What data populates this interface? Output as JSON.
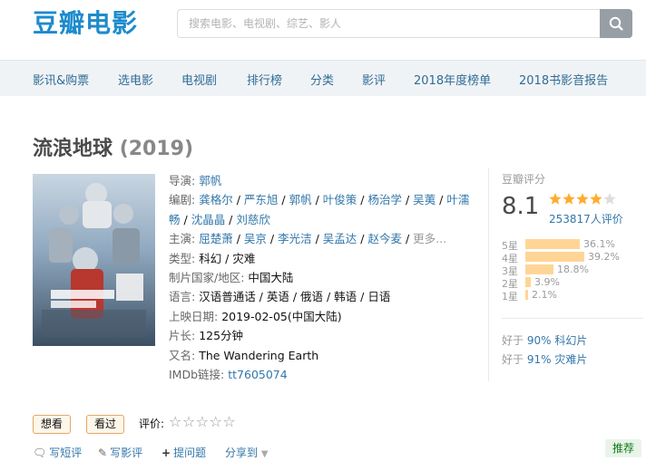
{
  "header": {
    "logo": "豆瓣电影",
    "search_placeholder": "搜索电影、电视剧、综艺、影人",
    "search_icon": "search-icon",
    "brand_color": "#1d8bcc"
  },
  "nav": {
    "items": [
      "影讯&购票",
      "选电影",
      "电视剧",
      "排行榜",
      "分类",
      "影评",
      "2018年度榜单",
      "2018书影音报告"
    ]
  },
  "movie": {
    "title": "流浪地球",
    "year": "(2019)",
    "info": {
      "director_label": "导演:",
      "director": "郭帆",
      "writer_label": "编剧:",
      "writers": [
        "龚格尔",
        "严东旭",
        "郭帆",
        "叶俊策",
        "杨治学",
        "吴荑",
        "叶濡畅",
        "沈晶晶",
        "刘慈欣"
      ],
      "cast_label": "主演:",
      "cast": [
        "屈楚萧",
        "吴京",
        "李光洁",
        "吴孟达",
        "赵今麦"
      ],
      "cast_more": "更多...",
      "genre_label": "类型:",
      "genre": "科幻 / 灾难",
      "country_label": "制片国家/地区:",
      "country": "中国大陆",
      "language_label": "语言:",
      "language": "汉语普通话 / 英语 / 俄语 / 韩语 / 日语",
      "release_label": "上映日期:",
      "release": "2019-02-05(中国大陆)",
      "runtime_label": "片长:",
      "runtime": "125分钟",
      "aka_label": "又名:",
      "aka": "The Wandering Earth",
      "imdb_label": "IMDb链接:",
      "imdb": "tt7605074"
    }
  },
  "rating": {
    "label": "豆瓣评分",
    "score": "8.1",
    "stars": 4,
    "votes": "253817人评价",
    "breakdown": [
      {
        "label": "5星",
        "pct": "36.1%",
        "value": 36.1
      },
      {
        "label": "4星",
        "pct": "39.2%",
        "value": 39.2
      },
      {
        "label": "3星",
        "pct": "18.8%",
        "value": 18.8
      },
      {
        "label": "2星",
        "pct": "3.9%",
        "value": 3.9
      },
      {
        "label": "1星",
        "pct": "2.1%",
        "value": 2.1
      }
    ],
    "better_than": [
      {
        "prefix": "好于",
        "pct": "90%",
        "genre": "科幻片"
      },
      {
        "prefix": "好于",
        "pct": "91%",
        "genre": "灾难片"
      }
    ],
    "star_color": "#ffac2d"
  },
  "actions": {
    "want": "想看",
    "seen": "看过",
    "rate_label": "评价:",
    "rate_stars": "☆☆☆☆☆",
    "short_review": "写短评",
    "review": "写影评",
    "question": "提问题",
    "share": "分享到",
    "recommend": "推荐"
  }
}
